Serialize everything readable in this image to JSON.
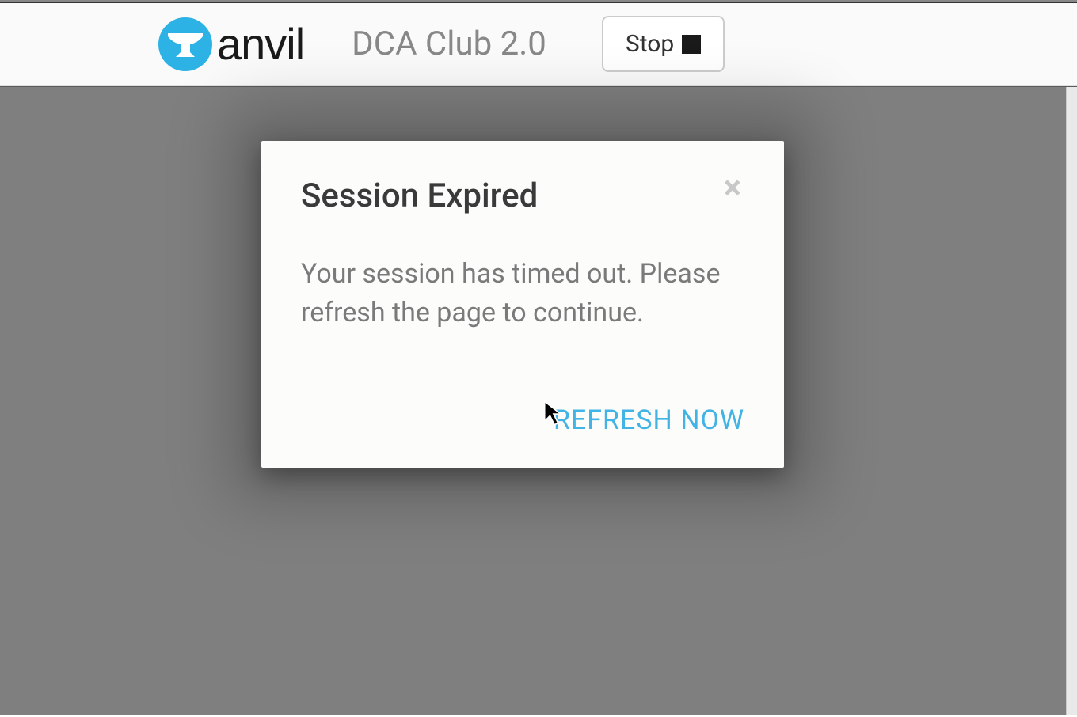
{
  "header": {
    "brand_wordmark": "anvil",
    "app_title": "DCA Club 2.0",
    "stop_label": "Stop"
  },
  "modal": {
    "title": "Session Expired",
    "body_text": "Your session has timed out. Please refresh the page to continue.",
    "refresh_label": "REFRESH NOW",
    "close_icon_name": "close-icon"
  },
  "colors": {
    "brand_blue": "#2db2e5",
    "link_blue": "#42b3e5",
    "body_gray": "#7f7f7f"
  }
}
